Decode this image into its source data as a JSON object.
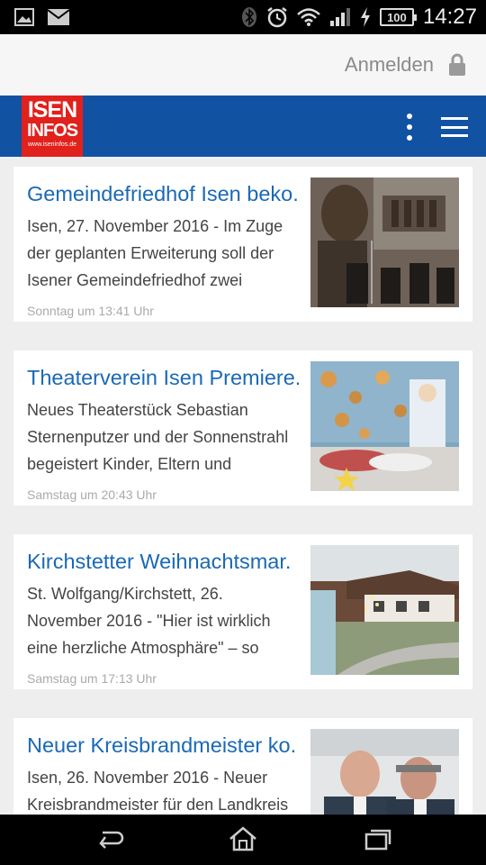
{
  "status_bar": {
    "time": "14:27",
    "battery": "100",
    "icons": [
      "image-icon",
      "mail-icon",
      "bluetooth-icon",
      "alarm-icon",
      "wifi-icon",
      "signal-icon",
      "charging-icon"
    ]
  },
  "header": {
    "login_label": "Anmelden",
    "logo_line1": "ISEN",
    "logo_line2": "INFOS",
    "logo_url": "www.iseninfos.de"
  },
  "colors": {
    "brand_blue": "#1252a3",
    "logo_red": "#e1211c",
    "title_blue": "#1a69b5"
  },
  "articles": [
    {
      "title": "Gemeindefriedhof Isen beko.",
      "excerpt": "Isen, 27. November 2016 - Im Zuge der geplanten Erweiterung soll der Isener Gemeindefriedhof zwei",
      "date": "Sonntag um 13:41 Uhr"
    },
    {
      "title": "Theaterverein Isen Premiere.",
      "excerpt": "Neues Theaterstück Sebastian Sternenputzer und der Sonnenstrahl begeistert Kinder, Eltern und",
      "date": "Samstag um 20:43 Uhr"
    },
    {
      "title": "Kirchstetter Weihnachtsmar.",
      "excerpt": "St. Wolfgang/Kirchstett, 26. November 2016 - \"Hier ist wirklich eine herzliche Atmosphäre\" – so",
      "date": "Samstag um 17:13 Uhr"
    },
    {
      "title": "Neuer Kreisbrandmeister ko.",
      "excerpt": "Isen, 26. November 2016 - Neuer Kreisbrandmeister für den Landkreis",
      "date": ""
    }
  ],
  "nav_bar": {
    "buttons": [
      "back-icon",
      "home-icon",
      "recent-apps-icon"
    ]
  }
}
